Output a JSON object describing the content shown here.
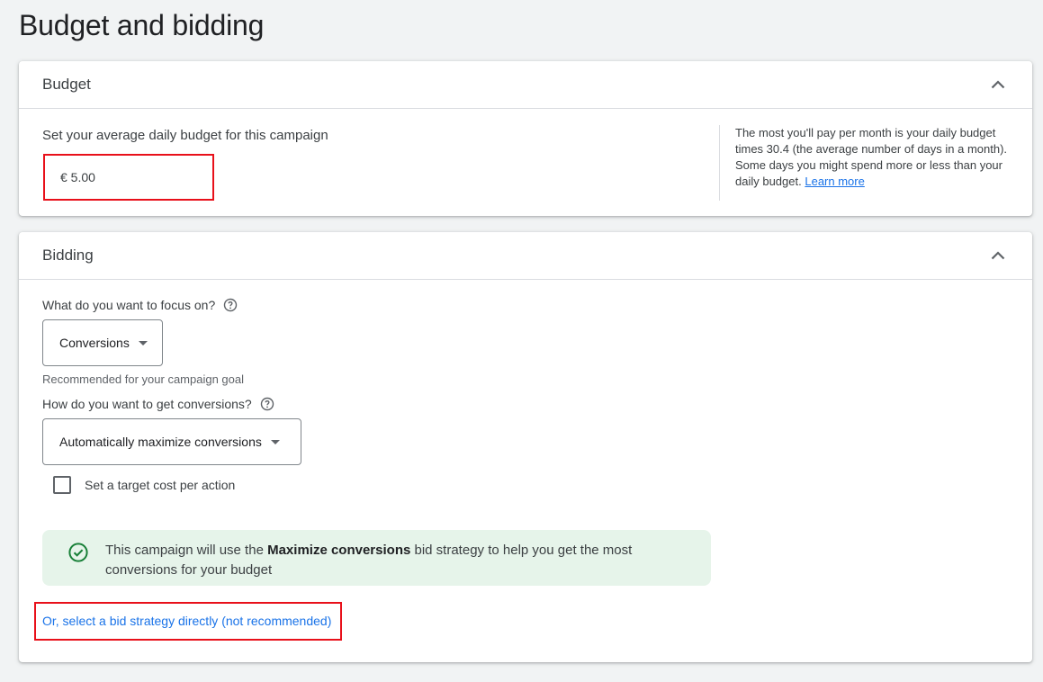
{
  "page": {
    "title": "Budget and bidding"
  },
  "budget": {
    "title": "Budget",
    "label": "Set your average daily budget for this campaign",
    "value": "€ 5.00",
    "help_text": "The most you'll pay per month is your daily budget times 30.4 (the average number of days in a month). Some days you might spend more or less than your daily budget.",
    "learn_more": "Learn more"
  },
  "bidding": {
    "title": "Bidding",
    "focus_question": "What do you want to focus on?",
    "focus_value": "Conversions",
    "focus_hint": "Recommended for your campaign goal",
    "conversions_question": "How do you want to get conversions?",
    "conversions_value": "Automatically maximize conversions",
    "target_cpa_label": "Set a target cost per action",
    "target_cpa_checked": false,
    "banner": {
      "prefix": "This campaign will use the ",
      "strategy": "Maximize conversions",
      "suffix": " bid strategy to help you get the most conversions for your budget"
    },
    "select_directly_link": "Or, select a bid strategy directly (not recommended)"
  },
  "colors": {
    "accent": "#1a73e8",
    "highlight": "#e8101a",
    "banner_bg": "#e6f4ea",
    "success": "#188038"
  },
  "icons": {
    "collapse": "chevron-up-icon",
    "help": "help-circle-icon",
    "dropdown": "caret-down-icon",
    "success": "check-circle-icon"
  }
}
